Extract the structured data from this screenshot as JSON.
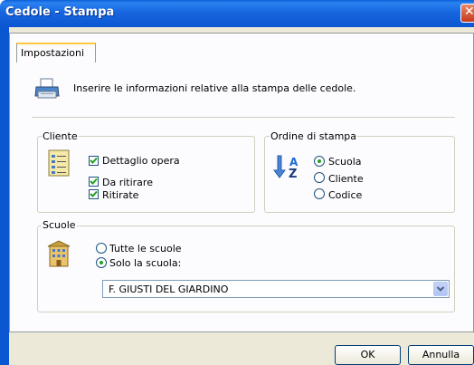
{
  "window": {
    "title": "Cedole - Stampa",
    "close_glyph": "✕"
  },
  "tabs": [
    {
      "label": "Impostazioni",
      "selected": true
    }
  ],
  "info": {
    "icon": "printer-icon",
    "text": "Inserire le informazioni relative alla stampa delle cedole."
  },
  "cliente": {
    "title": "Cliente",
    "icon": "document-list-icon",
    "options": [
      {
        "label": "Dettaglio opera",
        "checked": true
      },
      {
        "label": "Da ritirare",
        "checked": true
      },
      {
        "label": "Ritirate",
        "checked": true
      }
    ]
  },
  "ordine": {
    "title": "Ordine di stampa",
    "icon": "sort-az-icon",
    "options": [
      {
        "label": "Scuola",
        "selected": true
      },
      {
        "label": "Cliente",
        "selected": false
      },
      {
        "label": "Codice",
        "selected": false
      }
    ]
  },
  "scuole": {
    "title": "Scuole",
    "icon": "school-building-icon",
    "options": [
      {
        "label": "Tutte le scuole",
        "selected": false
      },
      {
        "label": "Solo la scuola:",
        "selected": true
      }
    ],
    "selected_school": "F. GIUSTI DEL GIARDINO"
  },
  "buttons": {
    "ok": "OK",
    "cancel": "Annulla"
  },
  "colors": {
    "title_bar": "#0b56d1",
    "radio_dot": "#21a121",
    "tab_highlight": "#ffc83c"
  }
}
